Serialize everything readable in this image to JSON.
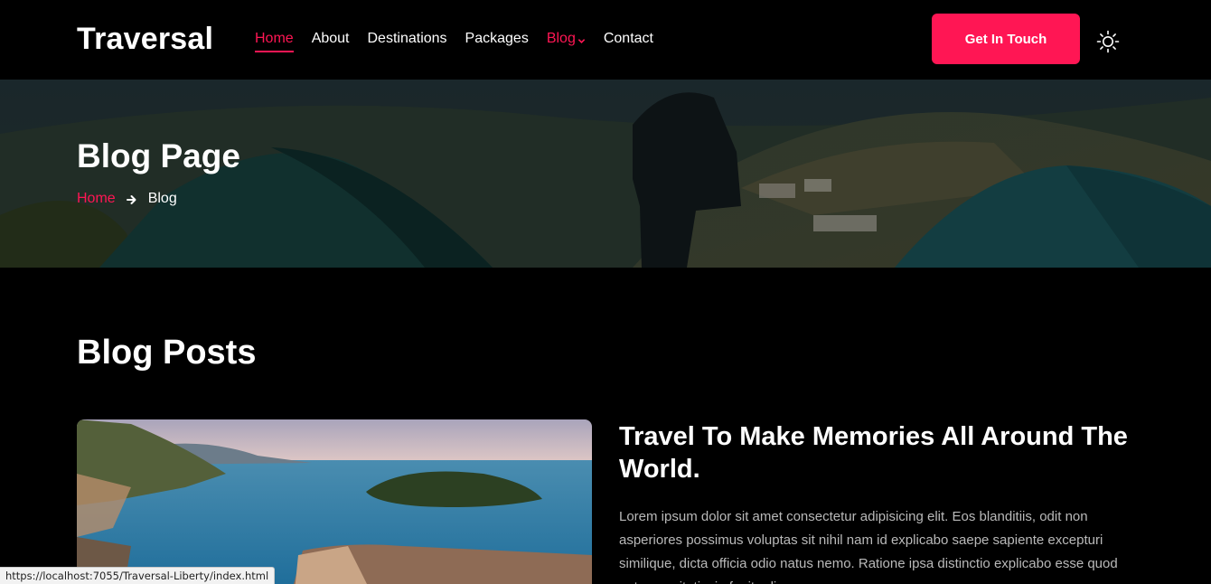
{
  "brand": {
    "name": "Traversal",
    "accent": "#ff1654"
  },
  "nav": {
    "items": [
      {
        "label": "Home"
      },
      {
        "label": "About"
      },
      {
        "label": "Destinations"
      },
      {
        "label": "Packages"
      },
      {
        "label": "Blog"
      },
      {
        "label": "Contact"
      }
    ],
    "cta": "Get In Touch",
    "theme_icon": "sun-icon"
  },
  "hero": {
    "title": "Blog Page",
    "breadcrumb": {
      "home": "Home",
      "current": "Blog"
    }
  },
  "blog": {
    "section_title": "Blog Posts",
    "posts": [
      {
        "title": "Travel To Make Memories All Around The World.",
        "excerpt": "Lorem ipsum dolor sit amet consectetur adipisicing elit. Eos blanditiis, odit non asperiores possimus voluptas sit nihil nam id explicabo saepe sapiente excepturi similique, dicta officia odio natus nemo. Ratione ipsa distinctio explicabo esse quod autem veritatis, in fugit odio."
      }
    ]
  },
  "status_bar": {
    "url": "https://localhost:7055/Traversal-Liberty/index.html"
  }
}
